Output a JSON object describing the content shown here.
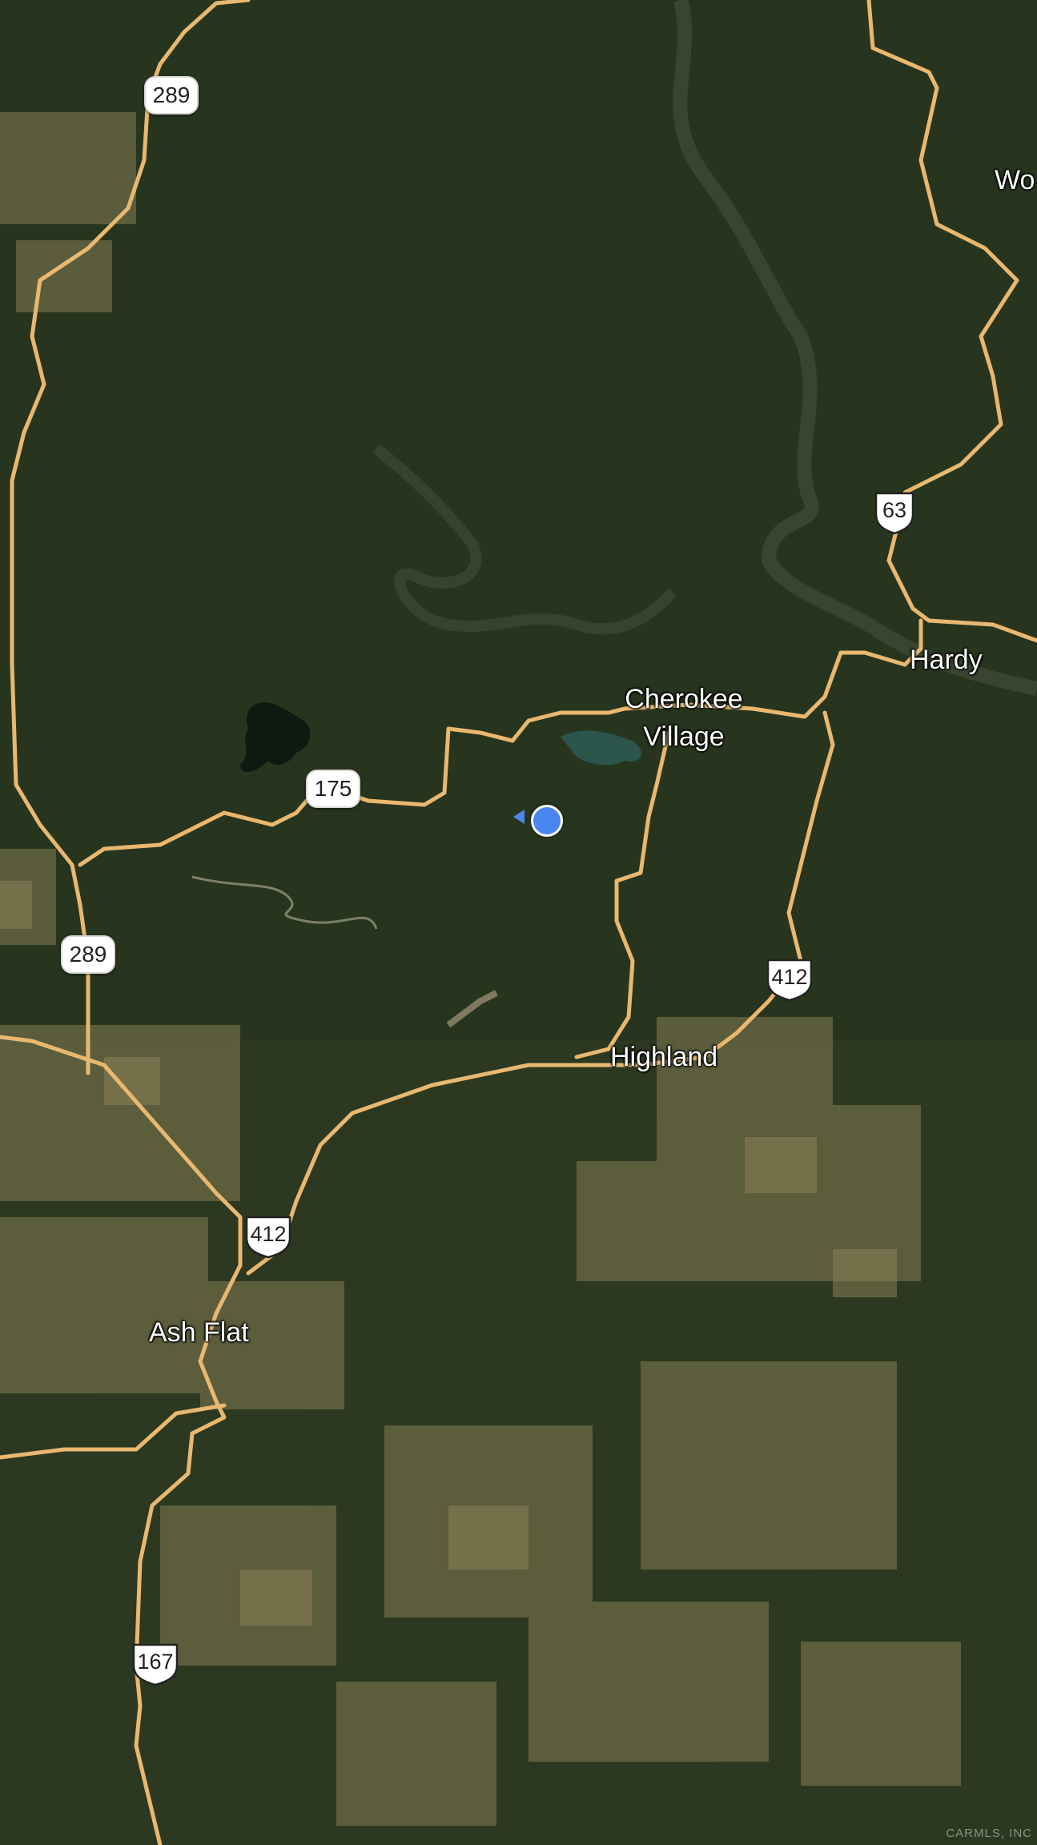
{
  "places": {
    "wo": "Wo",
    "hardy": "Hardy",
    "cherokee_village_line1": "Cherokee",
    "cherokee_village_line2": "Village",
    "highland": "Highland",
    "ash_flat": "Ash Flat"
  },
  "shields": {
    "hwy289_north": "289",
    "hwy289_south": "289",
    "hwy175": "175",
    "us63": "63",
    "us412_east": "412",
    "us412_west": "412",
    "us167": "167"
  },
  "attribution": "CARMLS, INC",
  "colors": {
    "terrain": "#2f3a22",
    "road": "#e9b870",
    "water": "#0d1a12",
    "location": "#4a86f0"
  }
}
